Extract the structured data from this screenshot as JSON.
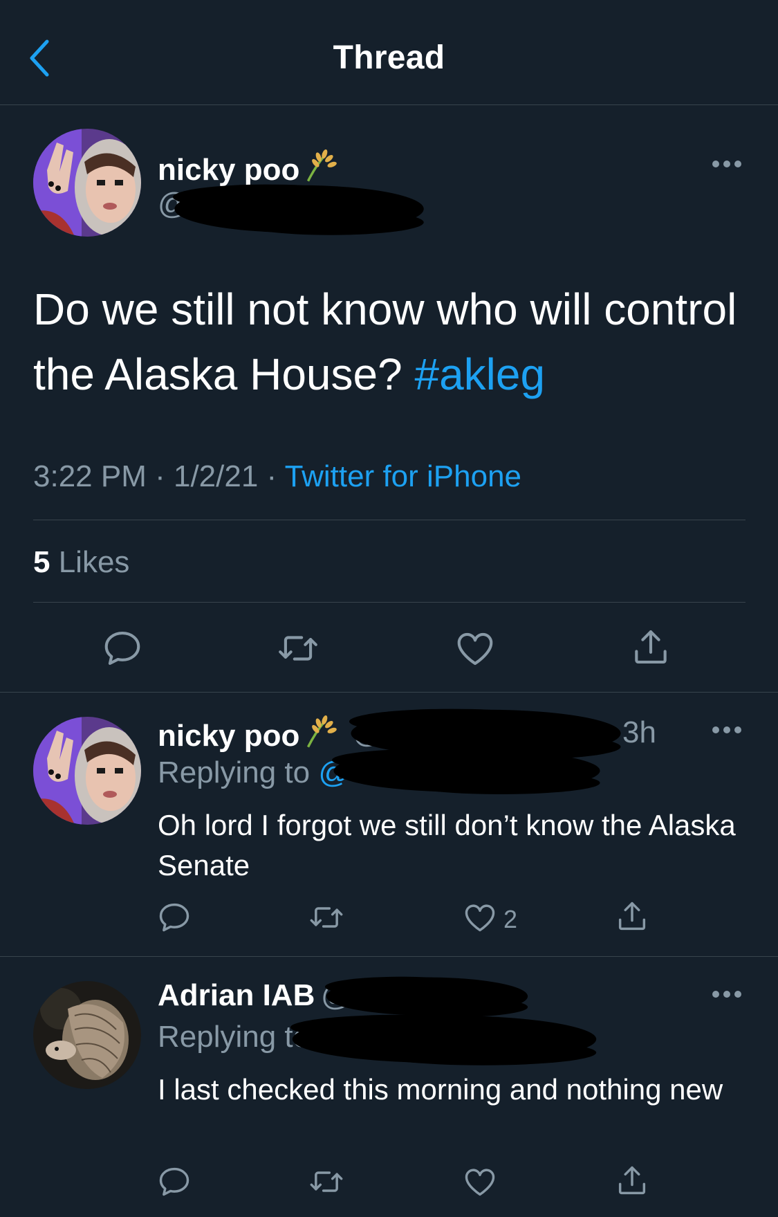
{
  "header": {
    "title": "Thread"
  },
  "main_tweet": {
    "author_name": "nicky poo",
    "handle_partial": "@",
    "text": "Do we still not know who will control the Alaska House? ",
    "hashtag": "#akleg",
    "time": "3:22 PM",
    "separator": " · ",
    "date": "1/2/21",
    "source": "Twitter for iPhone",
    "likes_count": "5",
    "likes_label": " Likes"
  },
  "replies": [
    {
      "author_name": "nicky poo",
      "handle_partial": "@",
      "time_partial": "3h",
      "replying_label": "Replying to ",
      "replying_partial": "@",
      "text": "Oh lord I forgot we still don’t know the Alaska Senate",
      "like_count": "2"
    },
    {
      "author_name": "Adrian IAB",
      "handle_partial": "@",
      "replying_label": "Replying to ",
      "replying_partial": "@",
      "text": "I last checked this morning and nothing new"
    }
  ],
  "colors": {
    "background": "#15202b",
    "accent": "#1da1f2",
    "secondary_text": "#8899a6",
    "divider": "#38444d"
  },
  "icons": [
    "back-chevron-icon",
    "more-icon",
    "reply-icon",
    "retweet-icon",
    "like-icon",
    "share-icon",
    "grain-emoji-icon"
  ]
}
